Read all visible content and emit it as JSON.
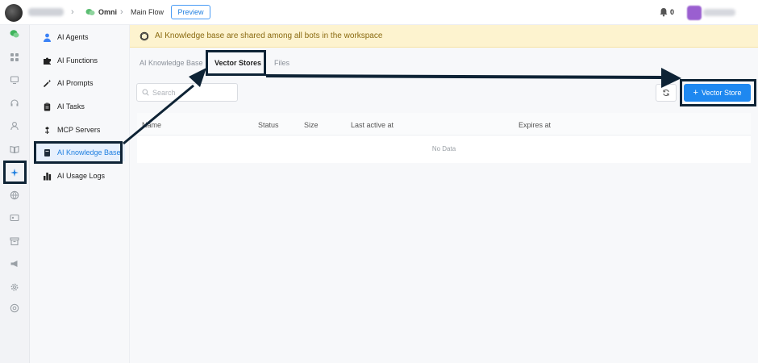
{
  "breadcrumb": {
    "project": "Omni",
    "flow": "Main Flow",
    "preview_label": "Preview"
  },
  "header": {
    "notification_count": "0"
  },
  "sidebar": {
    "items": [
      {
        "label": "AI Agents",
        "icon": "person-icon"
      },
      {
        "label": "AI Functions",
        "icon": "puzzle-icon"
      },
      {
        "label": "AI Prompts",
        "icon": "magic-wand-icon"
      },
      {
        "label": "AI Tasks",
        "icon": "clipboard-icon"
      },
      {
        "label": "MCP Servers",
        "icon": "server-icon"
      },
      {
        "label": "AI Knowledge Base",
        "icon": "book-icon",
        "active": true
      },
      {
        "label": "AI Usage Logs",
        "icon": "bar-chart-icon"
      }
    ]
  },
  "banner": {
    "text": "AI Knowledge base are shared among all bots in the workspace",
    "icon": "openai-icon"
  },
  "tabs": [
    {
      "label": "AI Knowledge Base"
    },
    {
      "label": "Vector Stores",
      "active": true
    },
    {
      "label": "Files"
    }
  ],
  "toolbar": {
    "search_placeholder": "Search",
    "add_label": "Vector Store",
    "add_icon": "plus-icon",
    "refresh_icon": "refresh-icon"
  },
  "table": {
    "columns": [
      "Name",
      "Status",
      "Size",
      "Last active at",
      "Expires at"
    ],
    "empty_text": "No Data"
  },
  "colors": {
    "accent": "#1e88f0",
    "banner_bg": "#fdf3cf",
    "annotation": "#0e2335"
  }
}
